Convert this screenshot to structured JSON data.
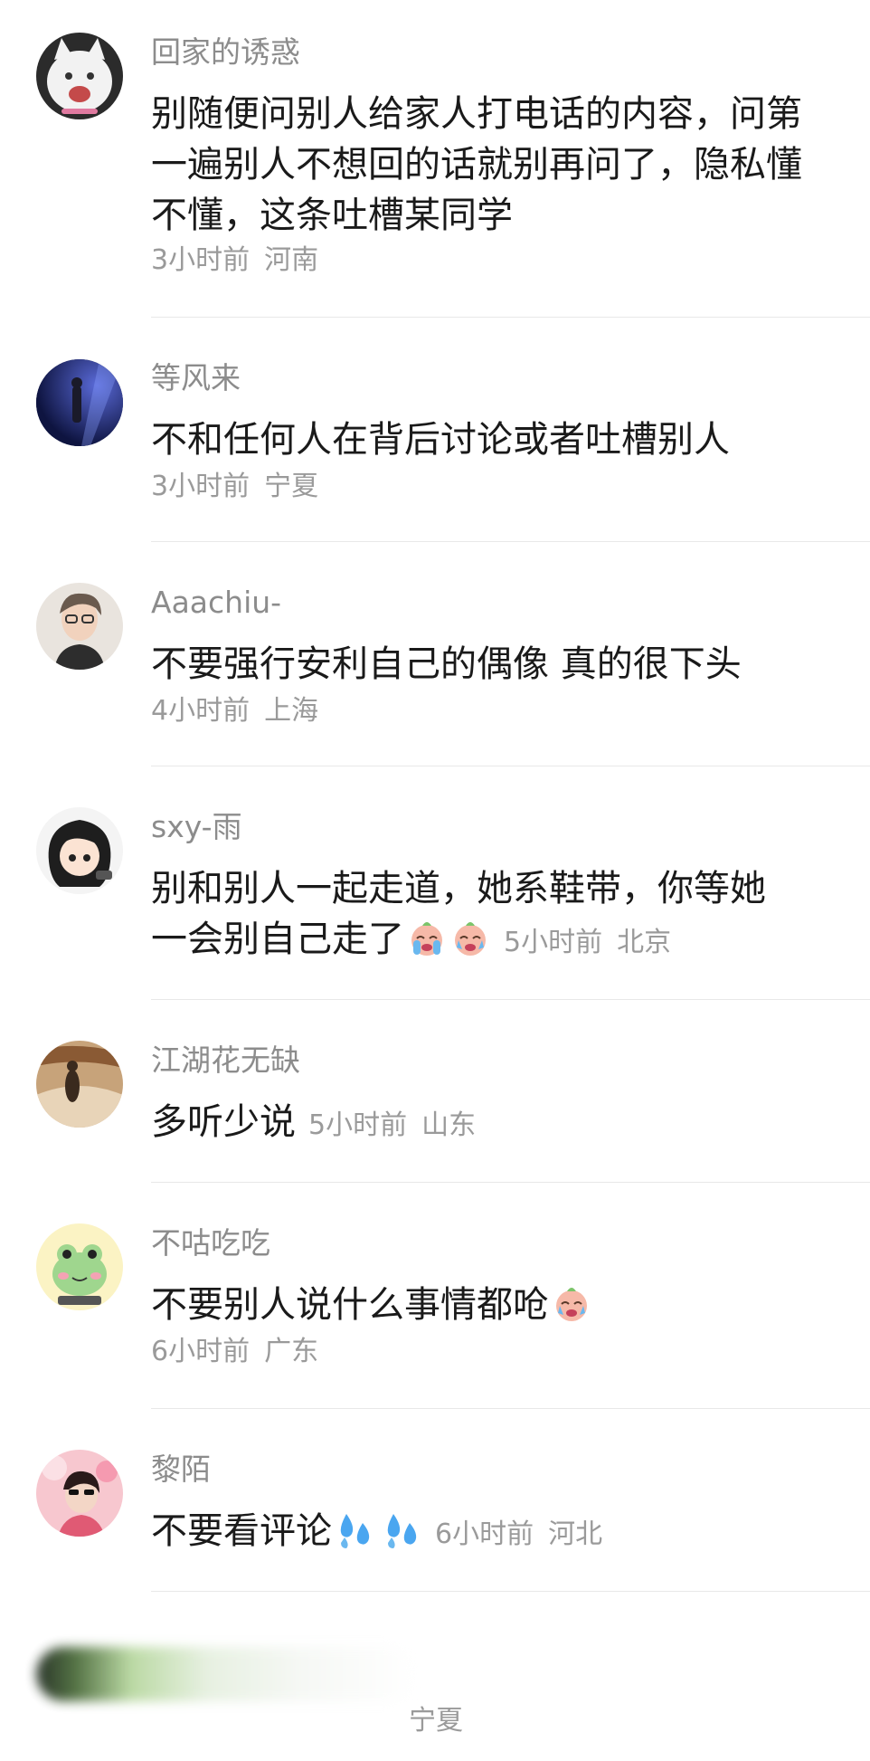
{
  "comments": [
    {
      "name": "回家的诱惑",
      "text": "别随便问别人给家人打电话的内容，问第一遍别人不想回的话就别再问了，隐私懂不懂，这条吐槽某同学",
      "time": "3小时前",
      "location": "河南"
    },
    {
      "name": "等风来",
      "text": "不和任何人在背后讨论或者吐槽别人",
      "time": "3小时前",
      "location": "宁夏"
    },
    {
      "name": "Aaachiu-",
      "text": "不要强行安利自己的偶像 真的很下头",
      "time": "4小时前",
      "location": "上海"
    },
    {
      "name": "sxy-雨",
      "text_line1": "别和别人一起走道，她系鞋带，你等她",
      "text_line2": "一会别自己走了",
      "emojis": [
        "crying-face-emoji",
        "crying-face-emoji"
      ],
      "time": "5小时前",
      "location": "北京"
    },
    {
      "name": "江湖花无缺",
      "text": "多听少说",
      "time": "5小时前",
      "location": "山东"
    },
    {
      "name": "不咕吃吃",
      "text": "不要别人说什么事情都呛",
      "emojis": [
        "crying-face-emoji"
      ],
      "time": "6小时前",
      "location": "广东"
    },
    {
      "name": "黎陌",
      "text": "不要看评论",
      "emojis": [
        "sweat-droplets-emoji",
        "sweat-droplets-emoji"
      ],
      "time": "6小时前",
      "location": "河北"
    }
  ],
  "partial_comment": {
    "location": "宁夏"
  }
}
